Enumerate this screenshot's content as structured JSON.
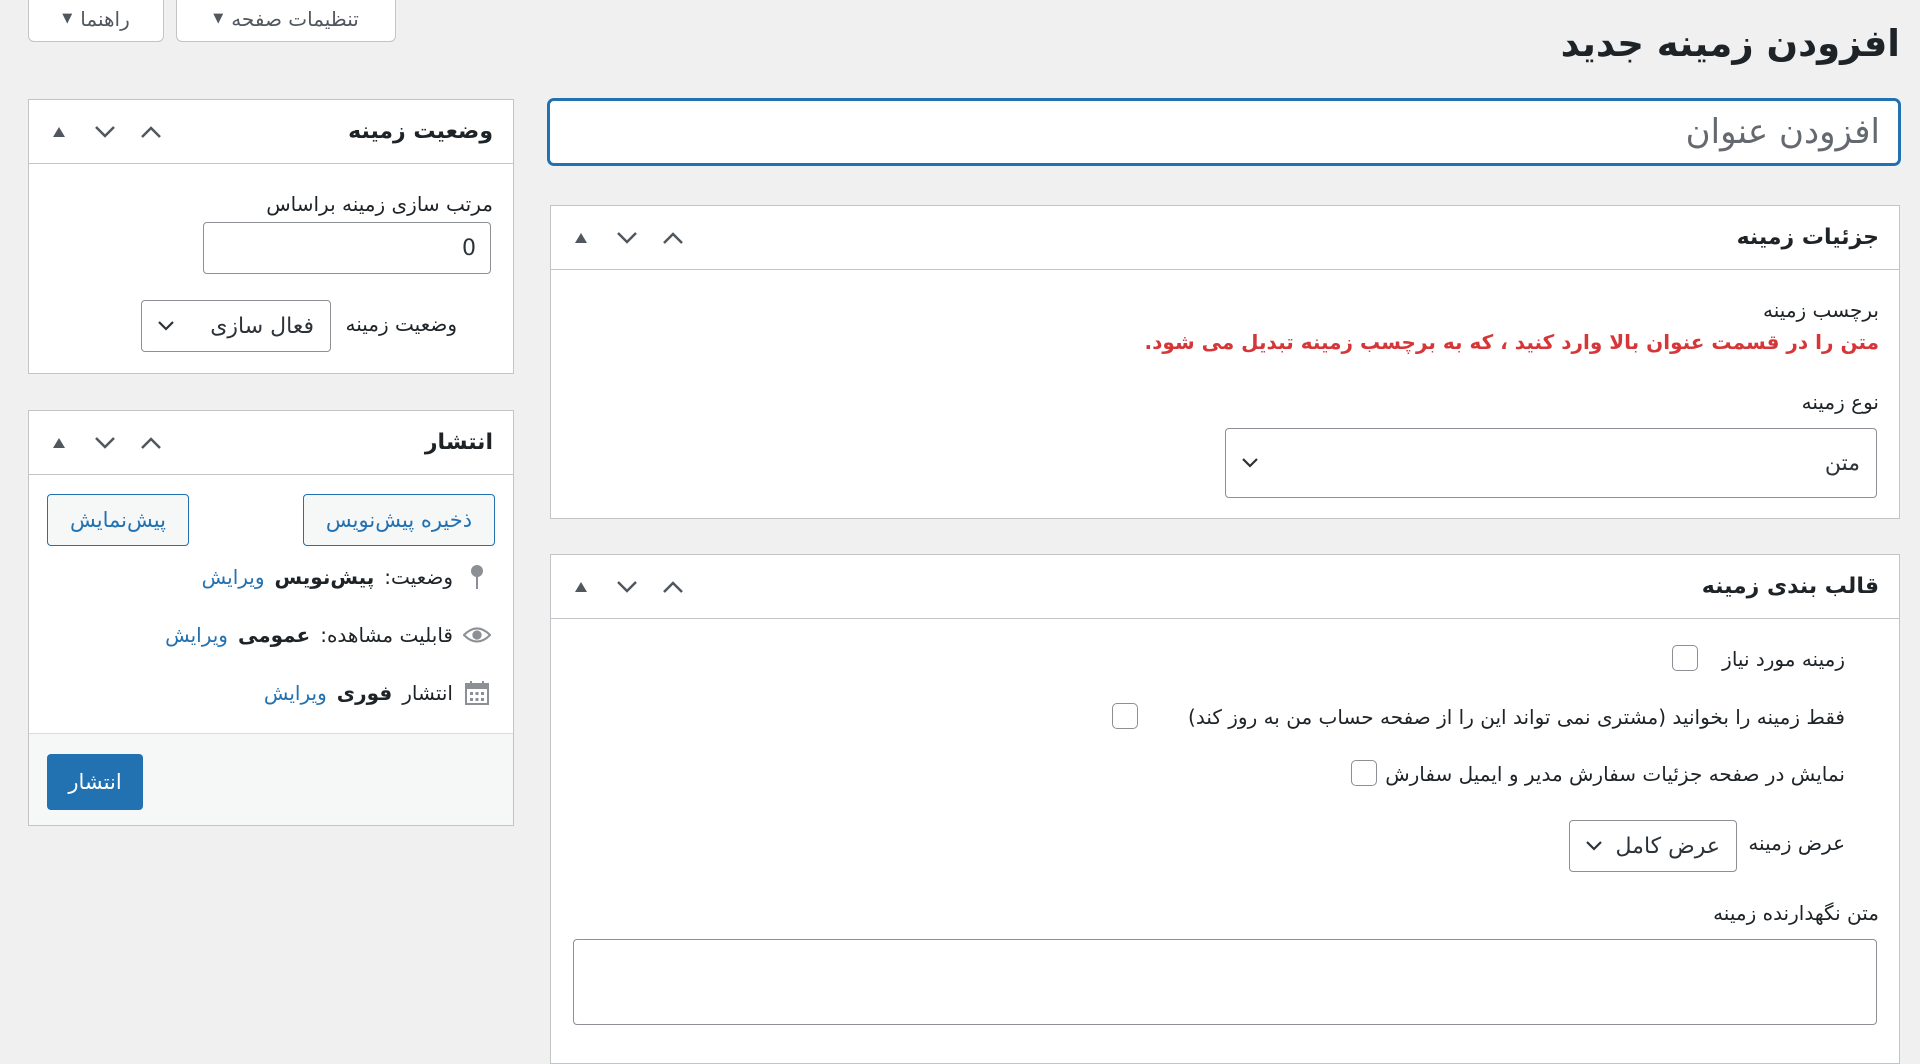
{
  "header": {
    "title": "افزودن زمینه جدید",
    "screen_options_label": "تنظیمات صفحه",
    "help_label": "راهنما"
  },
  "title_field": {
    "placeholder": "افزودن عنوان"
  },
  "field_details": {
    "title": "جزئیات زمینه",
    "label_heading": "برچسب زمینه",
    "label_note": "متن را در قسمت عنوان بالا وارد کنید ، که به برچسب زمینه تبدیل می شود.",
    "type_heading": "نوع زمینه",
    "type_value": "متن"
  },
  "field_format": {
    "title": "قالب بندی زمینه",
    "required_label": "زمینه مورد نیاز",
    "readonly_label": "فقط زمینه را بخوانید (مشتری نمی تواند این را از صفحه حساب من به روز کند)",
    "show_in_order_label": "نمایش در صفحه جزئیات سفارش مدیر و ایمیل سفارش",
    "width_label": "عرض زمینه",
    "width_value": "عرض کامل",
    "placeholder_heading": "متن نگهدارنده زمینه",
    "placeholder_value": ""
  },
  "field_status": {
    "title": "وضعیت زمینه",
    "sort_label": "مرتب سازی زمینه براساس",
    "sort_value": "0",
    "status_label": "وضعیت زمینه",
    "status_value": "فعال سازی"
  },
  "publish": {
    "title": "انتشار",
    "save_draft_label": "ذخیره پیش‌نویس",
    "preview_label": "پیش‌نمایش",
    "status_prefix": "وضعیت:",
    "status_value": "پیش‌نویس",
    "visibility_prefix": "قابلیت مشاهده:",
    "visibility_value": "عمومی",
    "schedule_prefix": "انتشار",
    "schedule_value": "فوری",
    "edit_label": "ویرایش",
    "publish_label": "انتشار"
  },
  "colors": {
    "accent": "#2271b1",
    "warning": "#d63638",
    "background": "#f0f0f1"
  }
}
